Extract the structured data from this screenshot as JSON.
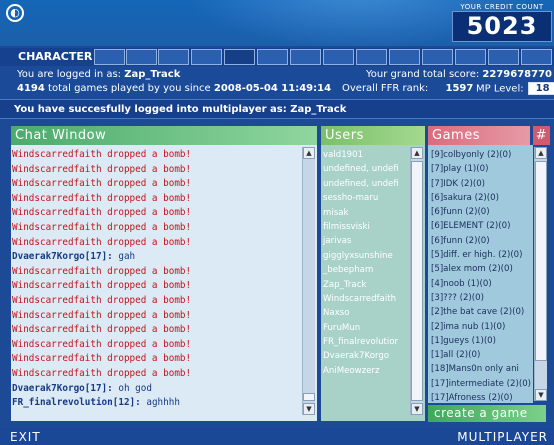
{
  "header": {
    "credit_label": "YOUR CREDIT COUNT",
    "credit_value": "5023"
  },
  "character_bar": {
    "label": "CHARACTER"
  },
  "info": {
    "logged_in_prefix": "You are logged in as:",
    "username": "Zap_Track",
    "games_played_count": "4194",
    "games_played_text": "total games played by you since",
    "since_datetime": "2008-05-04 11:49:14",
    "grand_total_label": "Your grand total score:",
    "grand_total_value": "2279678770",
    "ffr_rank_label": "Overall FFR rank:",
    "ffr_rank_value": "1597",
    "mp_level_label": "MP Level:",
    "mp_level_value": "18"
  },
  "notice": "You have succesfully logged into multiplayer as: Zap_Track",
  "chat": {
    "title": "Chat Window",
    "lines": [
      {
        "type": "red",
        "text": "Windscarredfaith dropped a bomb!"
      },
      {
        "type": "red",
        "text": "Windscarredfaith dropped a bomb!"
      },
      {
        "type": "red",
        "text": "Windscarredfaith dropped a bomb!"
      },
      {
        "type": "red",
        "text": "Windscarredfaith dropped a bomb!"
      },
      {
        "type": "red",
        "text": "Windscarredfaith dropped a bomb!"
      },
      {
        "type": "red",
        "text": "Windscarredfaith dropped a bomb!"
      },
      {
        "type": "red",
        "text": "Windscarredfaith dropped a bomb!"
      },
      {
        "type": "msg",
        "who": "Dvaerak7Korgo[17]:",
        "text": " gah"
      },
      {
        "type": "red",
        "text": "Windscarredfaith dropped a bomb!"
      },
      {
        "type": "red",
        "text": "Windscarredfaith dropped a bomb!"
      },
      {
        "type": "red",
        "text": "Windscarredfaith dropped a bomb!"
      },
      {
        "type": "red",
        "text": "Windscarredfaith dropped a bomb!"
      },
      {
        "type": "red",
        "text": "Windscarredfaith dropped a bomb!"
      },
      {
        "type": "red",
        "text": "Windscarredfaith dropped a bomb!"
      },
      {
        "type": "red",
        "text": "Windscarredfaith dropped a bomb!"
      },
      {
        "type": "red",
        "text": "Windscarredfaith dropped a bomb!"
      },
      {
        "type": "msg",
        "who": "Dvaerak7Korgo[17]:",
        "text": " oh god"
      },
      {
        "type": "msg",
        "who": "FR_finalrevolution[12]:",
        "text": " aghhhh"
      }
    ]
  },
  "users": {
    "title": "Users",
    "items": [
      "vald1901",
      "undefined, undefi",
      "undefined, undefi",
      "sessho-maru",
      "misak",
      "filmissviski",
      "jarivas",
      "gigglyxsunshine",
      "_bebepham",
      "Zap_Track",
      "Windscarredfaith",
      "Naxso",
      "FuruMun",
      "FR_finalrevolutior",
      "Dvaerak7Korgo",
      "AniMeowzerz"
    ]
  },
  "games": {
    "title": "Games",
    "hash": "#",
    "items": [
      "[9]colbyonly (2)(0)",
      "[7]play (1)(0)",
      "[7]IDK (2)(0)",
      "[6]sakura (2)(0)",
      "[6]funn (2)(0)",
      "[6]ELEMENT (2)(0)",
      "[6]funn (2)(0)",
      "[5]diff. er high. (2)(0)",
      "[5]alex mom (2)(0)",
      "[4]noob (1)(0)",
      "[3]??? (2)(0)",
      "[2]the bat cave (2)(0)",
      "[2]ima nub (1)(0)",
      "[1]gueys (1)(0)",
      "[1]all (2)(0)",
      "[18]Mans0n only ani",
      "[17]intermediate (2)(0)",
      "[17]Afroness (2)(0)"
    ],
    "create_label": "create a game"
  },
  "bottom": {
    "exit_label": "EXIT",
    "multiplayer_label": "MULTIPLAYER"
  },
  "colors": {
    "background": "#1d4a97",
    "chat_red": "#c4141c",
    "chat_blue": "#173a86",
    "chat_head": "#4cab6c",
    "games_head": "#d96c7d"
  }
}
